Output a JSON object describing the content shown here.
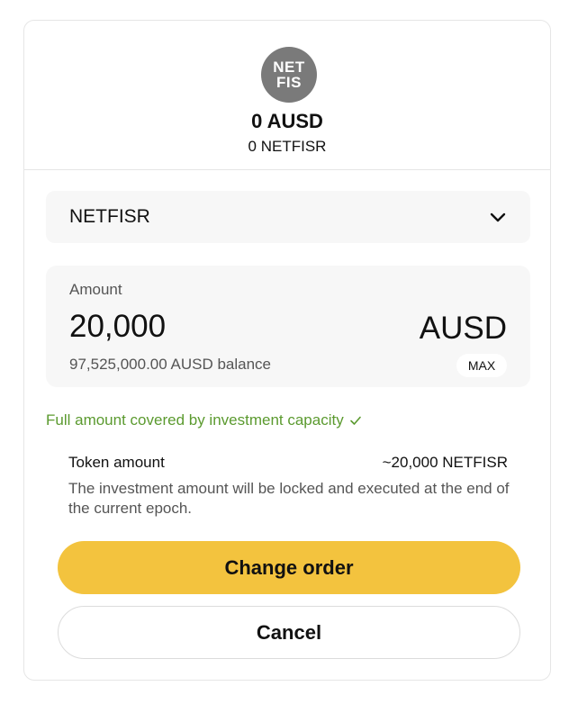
{
  "header": {
    "logo_line1": "NET",
    "logo_line2": "FIS",
    "balance_main": "0 AUSD",
    "balance_sub": "0 NETFISR"
  },
  "selector": {
    "selected": "NETFISR",
    "icon": "chevron-down-icon"
  },
  "amount": {
    "label": "Amount",
    "value": "20,000",
    "currency": "AUSD",
    "balance_text": "97,525,000.00 AUSD balance",
    "max_label": "MAX"
  },
  "capacity": {
    "text": "Full amount covered by investment capacity",
    "icon": "check-icon",
    "color": "#5b9a2f"
  },
  "token_row": {
    "label": "Token amount",
    "value": "~20,000 NETFISR"
  },
  "note": "The investment amount will be locked and executed at the end of the current epoch.",
  "actions": {
    "primary_label": "Change order",
    "primary_color": "#f3c33e",
    "secondary_label": "Cancel"
  }
}
